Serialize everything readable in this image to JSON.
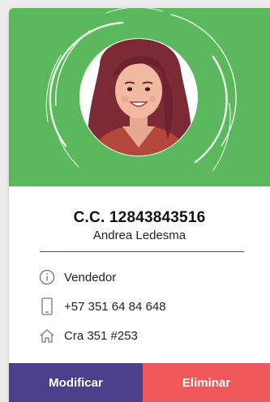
{
  "card": {
    "document_id": "C.C. 12843843516",
    "full_name": "Andrea Ledesma",
    "role": "Vendedor",
    "phone": "+57 351 64 84 648",
    "address": "Cra 351 #253",
    "icons": {
      "role": "info-icon",
      "phone": "phone-icon",
      "address": "home-icon"
    }
  },
  "actions": {
    "edit_label": "Modificar",
    "delete_label": "Eliminar"
  },
  "colors": {
    "hero_green": "#5cb85c",
    "edit_button": "#4c3f8c",
    "delete_button": "#f0585c",
    "divider": "#5a5080",
    "icon_stroke": "#777777"
  }
}
